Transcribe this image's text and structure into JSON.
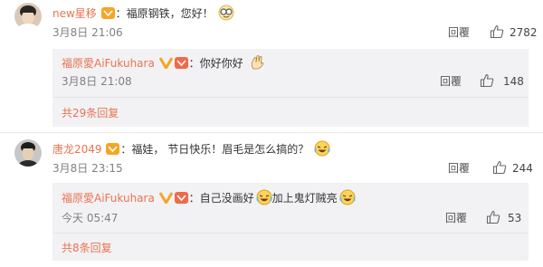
{
  "comments": [
    {
      "user": "new星移",
      "text": "：福原钢铁，您好！",
      "date": "3月8日 21:06",
      "reply_label": "回覆",
      "likes": "2782",
      "emoji_icon": "nerd-glasses-emoji",
      "reply": {
        "user": "福原愛AiFukuhara",
        "text": "：你好你好",
        "date": "3月8日 21:08",
        "reply_label": "回覆",
        "likes": "148",
        "emoji_icon": "waving-hand-emoji"
      },
      "more_replies": "共29条回复"
    },
    {
      "user": "唐龙2049",
      "text": "：福娃， 节日快乐！眉毛是怎么搞的？",
      "date": "3月8日 23:15",
      "reply_label": "回覆",
      "likes": "244",
      "emoji_icon": "laughing-tears-emoji",
      "reply": {
        "user": "福原愛AiFukuhara",
        "text_a": "：自己没画好",
        "text_b": "加上鬼灯贼亮",
        "date": "今天 05:47",
        "reply_label": "回覆",
        "likes": "53",
        "emoji_icon": "laughing-tears-emoji"
      },
      "more_replies": "共8条回复"
    }
  ],
  "colors": {
    "link": "#eb7350",
    "reply_bg": "#f2f2f5",
    "meta": "#808080"
  }
}
